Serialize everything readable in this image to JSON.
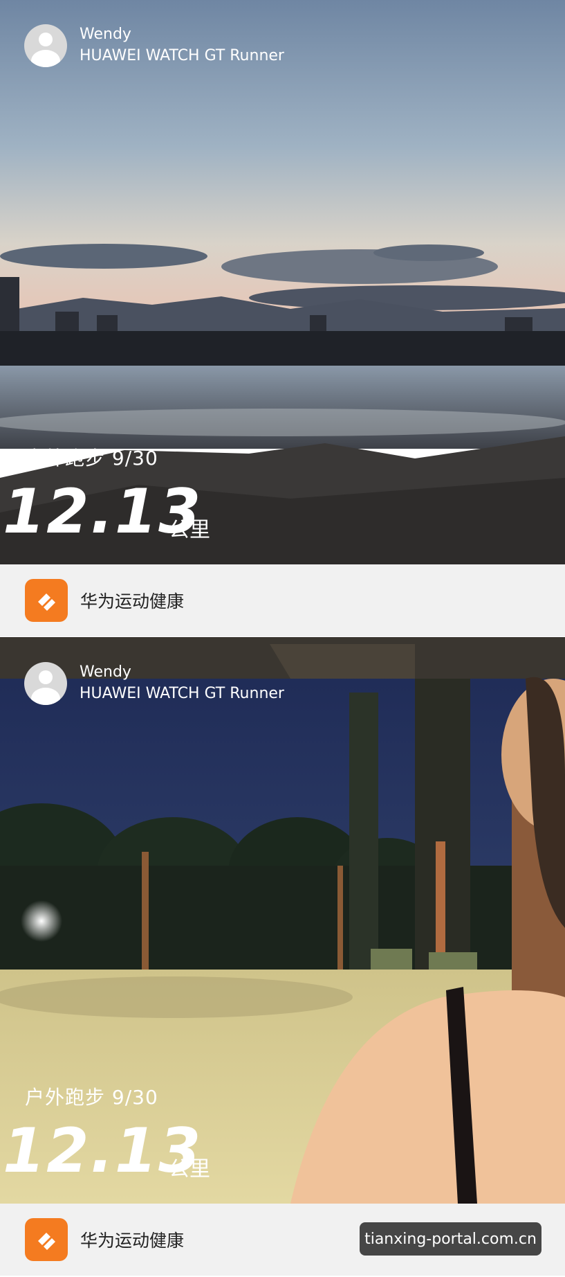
{
  "cards": [
    {
      "user_name": "Wendy",
      "device": "HUAWEI WATCH GT Runner",
      "activity": "户外跑步 9/30",
      "distance": "12.13",
      "unit": "公里",
      "app_name": "华为运动健康"
    },
    {
      "user_name": "Wendy",
      "device": "HUAWEI WATCH GT Runner",
      "activity": "户外跑步 9/30",
      "distance": "12.13",
      "unit": "公里",
      "app_name": "华为运动健康"
    }
  ],
  "watermark": "tianxing-portal.com.cn",
  "colors": {
    "app_orange": "#f47b20",
    "footer_bg": "#f1f1f1"
  },
  "icons": {
    "avatar": "user-avatar-icon",
    "app": "huawei-health-icon"
  }
}
